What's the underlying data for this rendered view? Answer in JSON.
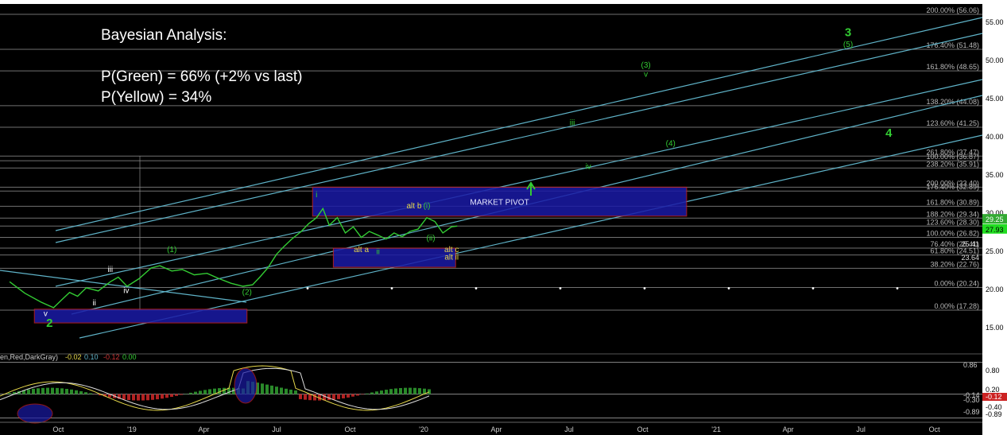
{
  "annotation": {
    "title": "Bayesian Analysis:",
    "line1": "P(Green) = 66% (+2% vs last)",
    "line2": "P(Yellow) = 34%"
  },
  "colors": {
    "background": "#000000",
    "price": "#33cc33",
    "channel": "#5fb3c8",
    "fib_line": "#8c8c8c",
    "pivot_box": "#1a1aa6",
    "pivot_border": "#cc2222",
    "green_label": "#33cc33",
    "yellow_label": "#e6d84a",
    "white_label": "#ffffff"
  },
  "chart_data": [
    {
      "type": "line",
      "panel": "price",
      "x_ticks": [
        "Oct",
        "'19",
        "Apr",
        "Jul",
        "Oct",
        "'20",
        "Apr",
        "Jul",
        "Oct",
        "'21",
        "Apr",
        "Jul",
        "Oct"
      ],
      "y_ticks": [
        15,
        20,
        25,
        30,
        35,
        40,
        45,
        50,
        55
      ],
      "ylim": [
        13,
        57
      ],
      "last_price": "27.93",
      "last_price_2": "29.25",
      "price_series": {
        "x": [
          "2018-08-01",
          "2018-08-20",
          "2018-09-10",
          "2018-09-25",
          "2018-10-05",
          "2018-10-15",
          "2018-10-25",
          "2018-11-05",
          "2018-11-20",
          "2018-12-05",
          "2018-12-15",
          "2018-12-26",
          "2019-01-10",
          "2019-01-25",
          "2019-02-05",
          "2019-02-20",
          "2019-03-05",
          "2019-03-20",
          "2019-04-05",
          "2019-04-20",
          "2019-05-05",
          "2019-05-20",
          "2019-06-01",
          "2019-06-10",
          "2019-06-20",
          "2019-07-01",
          "2019-07-10",
          "2019-07-20",
          "2019-08-01",
          "2019-08-10",
          "2019-08-20",
          "2019-08-28",
          "2019-09-05",
          "2019-09-15",
          "2019-09-25",
          "2019-10-05",
          "2019-10-15",
          "2019-10-25",
          "2019-11-05",
          "2019-11-15",
          "2019-11-25",
          "2019-12-05",
          "2019-12-15",
          "2019-12-25",
          "2020-01-05",
          "2020-01-15",
          "2020-01-25",
          "2020-02-05",
          "2020-02-12"
        ],
        "y": [
          21.0,
          19.5,
          18.3,
          17.6,
          18.6,
          19.6,
          19.1,
          20.2,
          19.8,
          21.0,
          21.6,
          20.4,
          21.4,
          22.8,
          23.1,
          22.4,
          22.6,
          21.9,
          22.1,
          21.4,
          20.8,
          20.4,
          20.6,
          21.6,
          22.8,
          24.6,
          25.6,
          26.6,
          27.6,
          28.6,
          29.4,
          30.6,
          28.4,
          29.4,
          27.4,
          28.2,
          26.8,
          27.6,
          27.1,
          26.6,
          27.4,
          26.9,
          27.6,
          27.9,
          29.4,
          28.9,
          27.4,
          28.2,
          28.3
        ]
      },
      "fib_levels": [
        {
          "pct": "200.00%",
          "value": 56.06
        },
        {
          "pct": "176.40%",
          "value": 51.48
        },
        {
          "pct": "161.80%",
          "value": 48.65
        },
        {
          "pct": "138.20%",
          "value": 44.08
        },
        {
          "pct": "123.60%",
          "value": 41.25
        },
        {
          "pct": "261.80%",
          "value": 37.47
        },
        {
          "pct": "100.00%",
          "value": 36.87
        },
        {
          "pct": "238.20%",
          "value": 35.91
        },
        {
          "pct": "200.00%",
          "value": 33.4
        },
        {
          "pct": "176.40%",
          "value": 32.89
        },
        {
          "pct": "161.80%",
          "value": 30.89
        },
        {
          "pct": "188.20%",
          "value": 29.34
        },
        {
          "pct": "123.60%",
          "value": 28.3
        },
        {
          "pct": "100.00%",
          "value": 26.82
        },
        {
          "pct": "76.40%",
          "value": 25.41
        },
        {
          "pct": "61.80%",
          "value": 24.51
        },
        {
          "pct": "38.20%",
          "value": 22.76
        },
        {
          "pct": "0.00%",
          "value": 20.24
        },
        {
          "pct": "0.00%",
          "value": 17.28
        }
      ],
      "extra_labels": [
        "25.41",
        "23.64"
      ],
      "wave_labels": [
        {
          "text": "3",
          "color": "green",
          "x": "2021-06-15",
          "y": 53.2
        },
        {
          "text": "(5)",
          "color": "green",
          "x": "2021-06-15",
          "y": 51.8
        },
        {
          "text": "(3)",
          "color": "green",
          "x": "2020-10-05",
          "y": 49.1
        },
        {
          "text": "v",
          "color": "green",
          "x": "2020-10-05",
          "y": 47.9
        },
        {
          "text": "iii",
          "color": "green",
          "x": "2020-07-05",
          "y": 41.5
        },
        {
          "text": "(4)",
          "color": "green",
          "x": "2020-11-05",
          "y": 38.8
        },
        {
          "text": "4",
          "color": "green",
          "x": "2021-08-05",
          "y": 40.0
        },
        {
          "text": "iv",
          "color": "green",
          "x": "2020-07-25",
          "y": 35.8
        },
        {
          "text": "i",
          "color": "green",
          "x": "2019-08-20",
          "y": 32.1
        },
        {
          "text": "alt b",
          "color": "yellow",
          "x": "2019-12-20",
          "y": 30.6
        },
        {
          "text": "(i)",
          "color": "green",
          "x": "2020-01-05",
          "y": 30.6
        },
        {
          "text": "(ii)",
          "color": "green",
          "x": "2020-01-10",
          "y": 26.4
        },
        {
          "text": "alt a",
          "color": "yellow",
          "x": "2019-10-15",
          "y": 24.9
        },
        {
          "text": "ii",
          "color": "green",
          "x": "2019-11-05",
          "y": 24.6
        },
        {
          "text": "alt c",
          "color": "yellow",
          "x": "2020-02-05",
          "y": 24.9
        },
        {
          "text": "alt ii",
          "color": "yellow",
          "x": "2020-02-05",
          "y": 23.9
        },
        {
          "text": "(1)",
          "color": "green",
          "x": "2019-02-20",
          "y": 24.9
        },
        {
          "text": "iii",
          "color": "white",
          "x": "2018-12-05",
          "y": 22.3
        },
        {
          "text": "iv",
          "color": "white",
          "x": "2018-12-25",
          "y": 19.5
        },
        {
          "text": "ii",
          "color": "white",
          "x": "2018-11-15",
          "y": 17.9
        },
        {
          "text": "(2)",
          "color": "green",
          "x": "2019-05-25",
          "y": 19.3
        },
        {
          "text": "v",
          "color": "white",
          "x": "2018-09-15",
          "y": 16.5
        },
        {
          "text": "2",
          "color": "green",
          "x": "2018-09-20",
          "y": 15.1
        }
      ],
      "zones": [
        {
          "label": "MARKET PIVOT",
          "x0": "2019-08-15",
          "x1": "2020-11-25",
          "y0": 29.6,
          "y1": 33.4
        },
        {
          "label": "",
          "x0": "2019-09-10",
          "x1": "2020-02-10",
          "y0": 22.9,
          "y1": 25.4
        },
        {
          "label": "",
          "x0": "2018-09-01",
          "x1": "2019-05-25",
          "y0": 15.6,
          "y1": 17.4
        }
      ]
    },
    {
      "type": "line",
      "panel": "oscillator",
      "legend_text": "en,Red,DarkGray)",
      "legend_values": [
        {
          "text": "-0.02",
          "color": "yellow"
        },
        {
          "text": "0.10",
          "color": "teal"
        },
        {
          "text": "-0.12",
          "color": "red"
        },
        {
          "text": "0.00",
          "color": "green"
        }
      ],
      "y_ticks": [
        "0.86",
        "0.80",
        "0.20",
        "-0.14",
        "-0.30",
        "-0.40",
        "-0.89",
        "-0.89"
      ],
      "marker_labels": [
        "-0.12"
      ],
      "ylim": [
        -1.0,
        1.0
      ]
    }
  ]
}
